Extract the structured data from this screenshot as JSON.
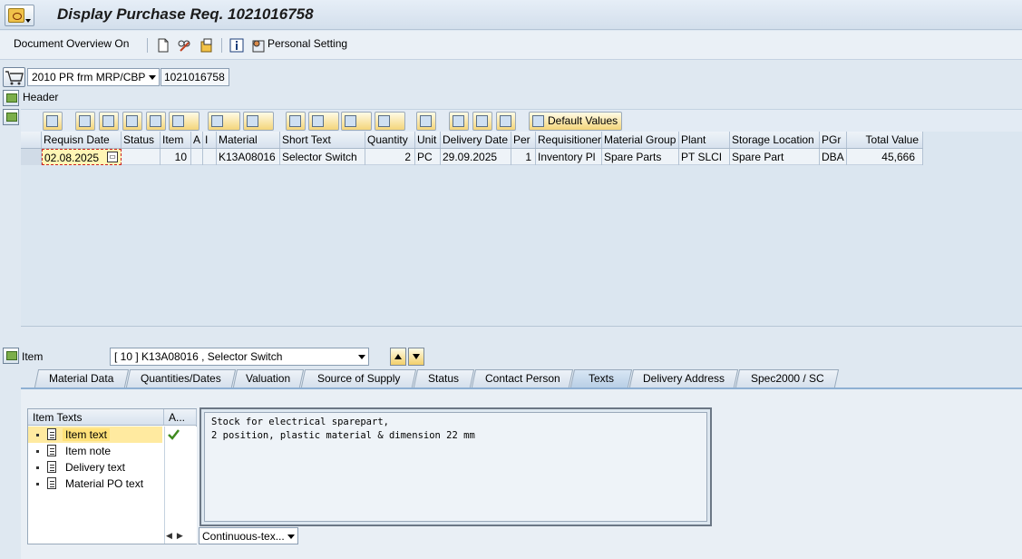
{
  "window": {
    "title": "Display Purchase Req. 1021016758"
  },
  "app_toolbar": {
    "document_overview": "Document Overview On",
    "personal_setting": "Personal Setting"
  },
  "req_header": {
    "doc_type": "2010 PR frm MRP/CBP",
    "doc_number": "1021016758",
    "header_label": "Header"
  },
  "grid_toolbar": {
    "default_values": "Default Values"
  },
  "grid": {
    "columns": [
      "Requisn Date",
      "Status",
      "Item",
      "A",
      "I",
      "Material",
      "Short Text",
      "Quantity",
      "Unit",
      "Delivery Date",
      "Per",
      "Requisitioner",
      "Material Group",
      "Plant",
      "Storage Location",
      "PGr",
      "Total Value"
    ],
    "rows": [
      {
        "requisn_date": "02.08.2025",
        "status": "",
        "item": "10",
        "a": "",
        "i": "",
        "material": "K13A08016",
        "short_text": "Selector Switch",
        "quantity": "2",
        "unit": "PC",
        "delivery_date": "29.09.2025",
        "per": "1",
        "requisitioner": "Inventory Pl",
        "material_group": "Spare Parts",
        "plant": "PT SLCI",
        "storage_location": "Spare Part",
        "pgr": "DBA",
        "total_value": "45,666"
      }
    ]
  },
  "item_section": {
    "label": "Item",
    "selected_item": "[ 10 ] K13A08016 , Selector Switch"
  },
  "tabs": [
    {
      "label": "Material Data"
    },
    {
      "label": "Quantities/Dates"
    },
    {
      "label": "Valuation"
    },
    {
      "label": "Source of Supply"
    },
    {
      "label": "Status"
    },
    {
      "label": "Contact Person"
    },
    {
      "label": "Texts",
      "active": true
    },
    {
      "label": "Delivery Address"
    },
    {
      "label": "Spec2000 / SC"
    }
  ],
  "texts_panel": {
    "header": "Item Texts",
    "col_a": "A...",
    "items": [
      "Item text",
      "Item note",
      "Delivery text",
      "Material PO text"
    ],
    "editor_text": "Stock for electrical sparepart,\n2 position, plastic material & dimension 22 mm",
    "mode": "Continuous-tex..."
  },
  "colors": {
    "selection": "#ffe17a",
    "active_tab": "#b9cfe6",
    "background": "#dfe8f1"
  }
}
